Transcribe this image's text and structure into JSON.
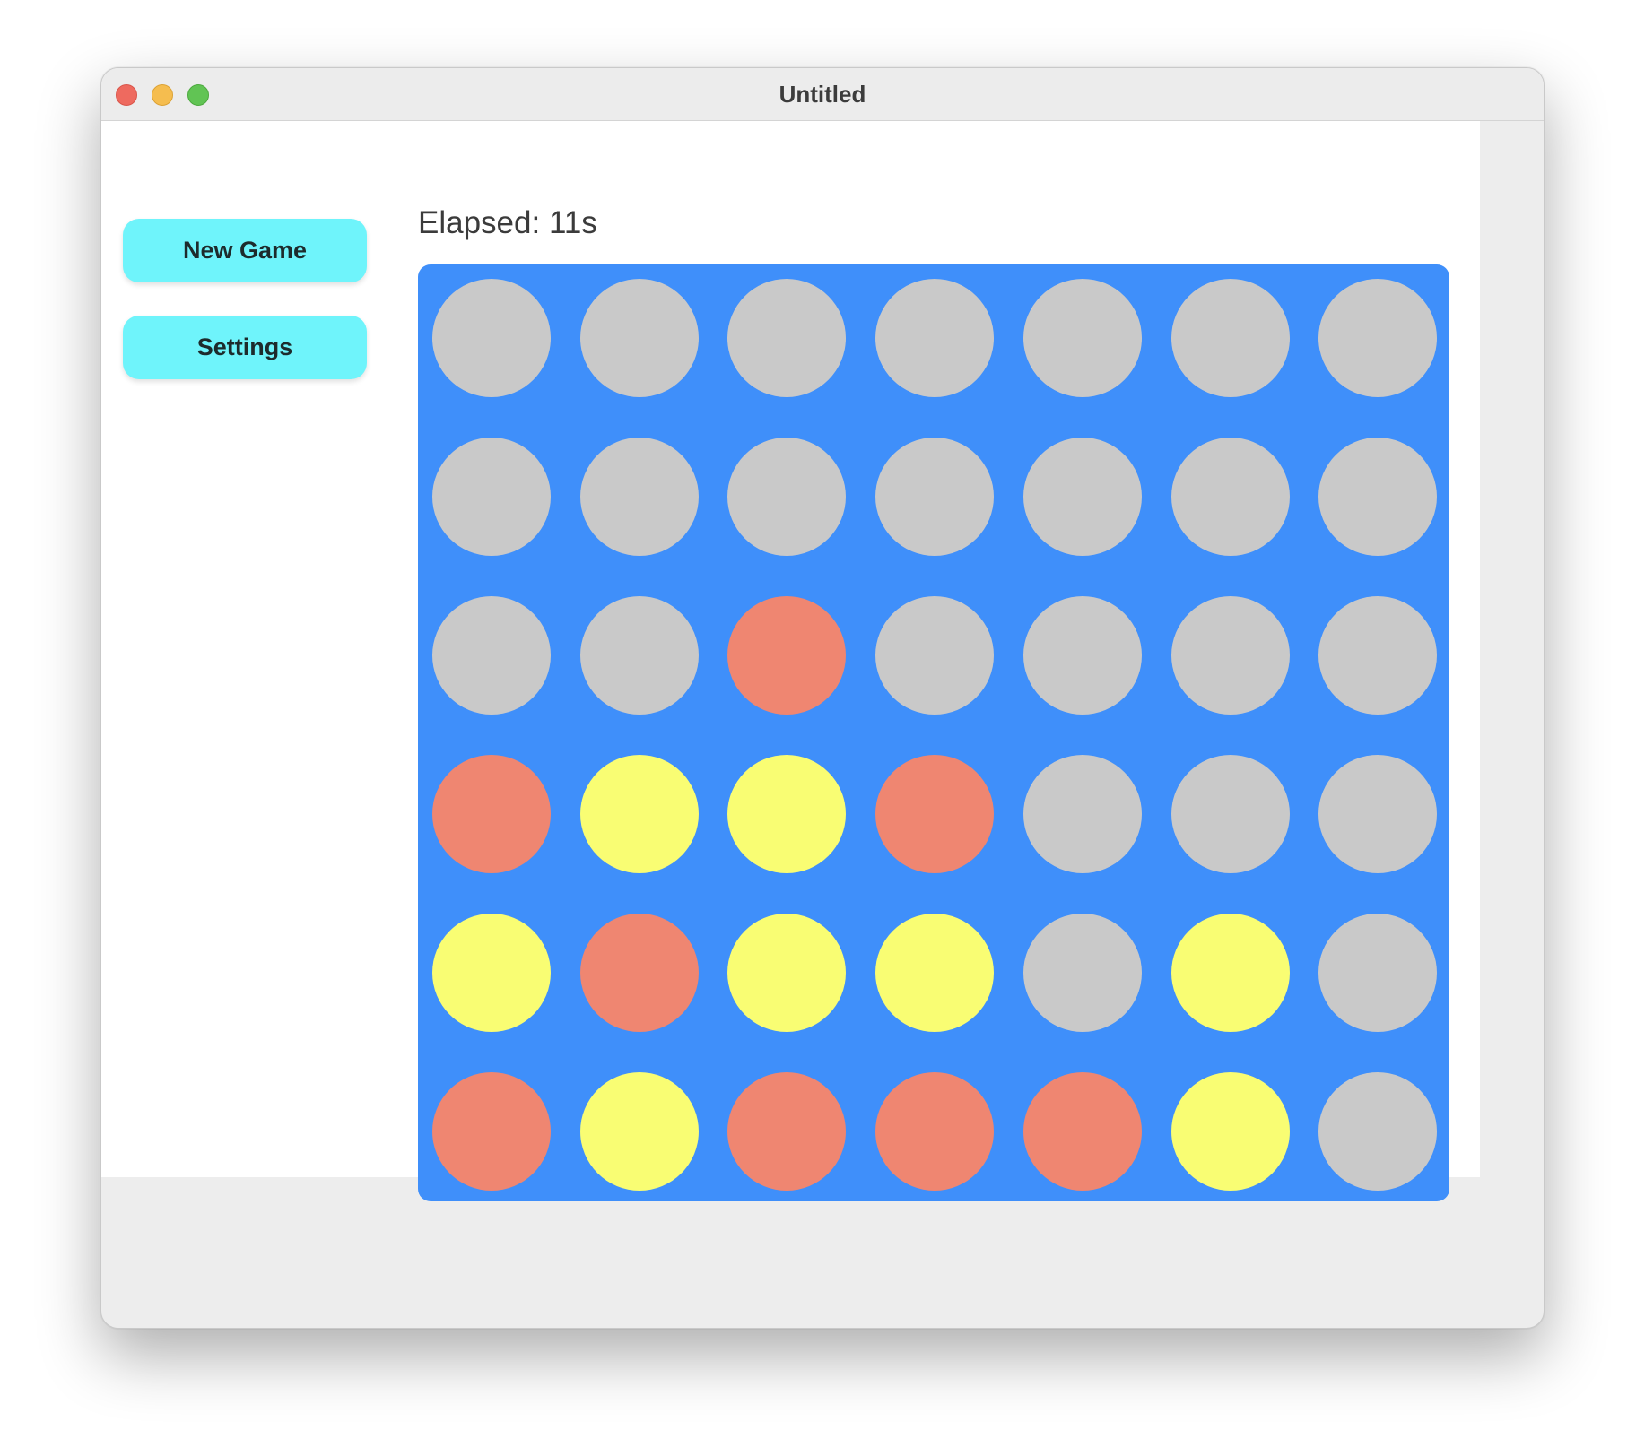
{
  "window": {
    "title": "Untitled"
  },
  "sidebar": {
    "new_game_label": "New Game",
    "settings_label": "Settings"
  },
  "status": {
    "elapsed_label": "Elapsed:",
    "elapsed_value": "11s"
  },
  "colors": {
    "board": "#3f8ffa",
    "empty": "#c9c9c9",
    "red": "#ef8671",
    "yellow": "#f9fd73",
    "button": "#6ff4fb"
  },
  "board": {
    "rows": 6,
    "columns": 7,
    "cells": [
      [
        "empty",
        "empty",
        "empty",
        "empty",
        "empty",
        "empty",
        "empty"
      ],
      [
        "empty",
        "empty",
        "empty",
        "empty",
        "empty",
        "empty",
        "empty"
      ],
      [
        "empty",
        "empty",
        "red",
        "empty",
        "empty",
        "empty",
        "empty"
      ],
      [
        "red",
        "yellow",
        "yellow",
        "red",
        "empty",
        "empty",
        "empty"
      ],
      [
        "yellow",
        "red",
        "yellow",
        "yellow",
        "empty",
        "yellow",
        "empty"
      ],
      [
        "red",
        "yellow",
        "red",
        "red",
        "red",
        "yellow",
        "empty"
      ]
    ]
  }
}
